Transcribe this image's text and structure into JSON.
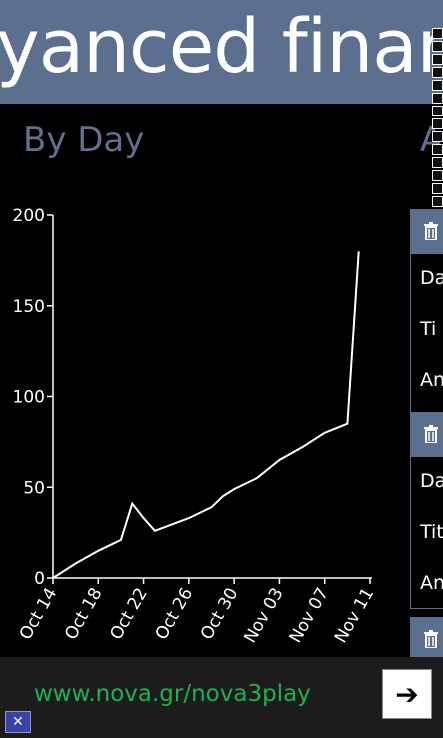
{
  "header": {
    "title": "yanced finance"
  },
  "sections": {
    "by_day": "By Day",
    "next_peek": "A"
  },
  "cards": [
    {
      "rows": [
        "Da",
        "Ti",
        "An"
      ]
    },
    {
      "rows": [
        "Da",
        "Tit",
        "An"
      ]
    }
  ],
  "ad": {
    "url": "www.nova.gr/nova3play",
    "go_icon": "arrow-right-icon",
    "close_icon": "close-icon"
  },
  "colors": {
    "accent": "#5b6f8f",
    "ad_text": "#1cb34b",
    "line": "#ffffff"
  },
  "chart_data": {
    "type": "line",
    "x": [
      "Oct 14",
      "Oct 16",
      "Oct 18",
      "Oct 20",
      "Oct 21",
      "Oct 22",
      "Oct 23",
      "Oct 26",
      "Oct 28",
      "Oct 29",
      "Oct 30",
      "Nov 01",
      "Nov 03",
      "Nov 05",
      "Nov 07",
      "Nov 09",
      "Nov 10"
    ],
    "values": [
      0,
      8,
      15,
      21,
      41,
      33,
      26,
      33,
      39,
      45,
      49,
      55,
      65,
      72,
      80,
      85,
      180
    ],
    "xticks": [
      "Oct 14",
      "Oct 18",
      "Oct 22",
      "Oct 26",
      "Oct 30",
      "Nov 03",
      "Nov 07",
      "Nov 11"
    ],
    "yticks": [
      0,
      50,
      100,
      150,
      200
    ],
    "ylim": [
      0,
      200
    ]
  }
}
